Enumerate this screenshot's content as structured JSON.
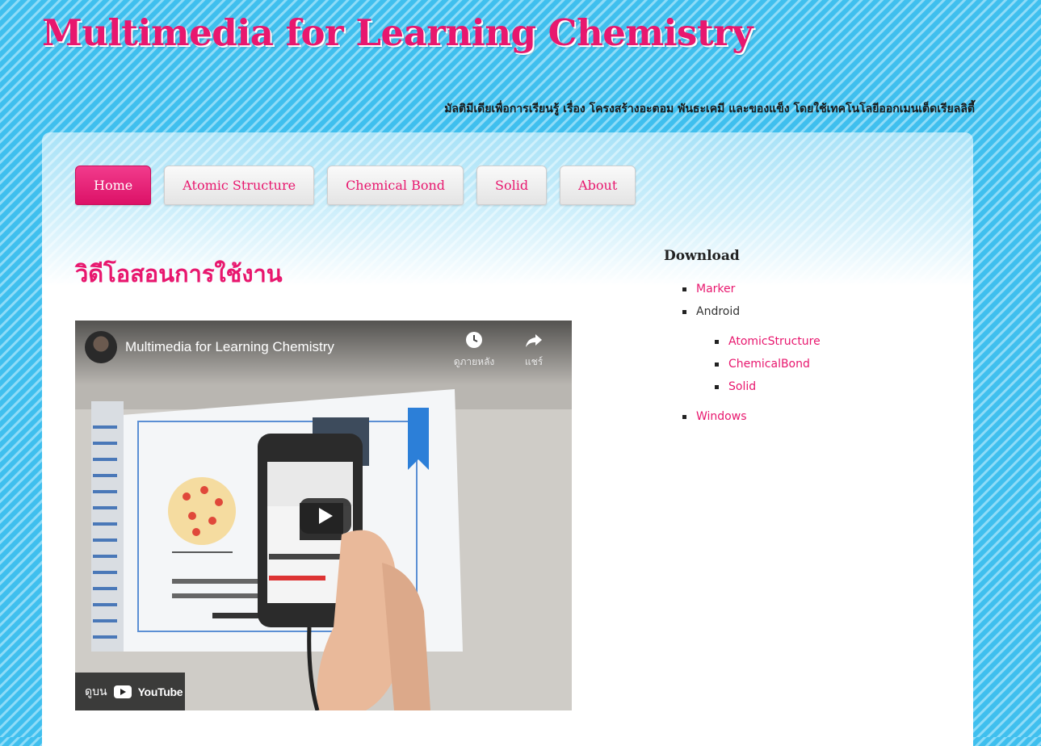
{
  "site": {
    "title": "Multimedia for Learning Chemistry",
    "tagline": "มัลติมีเดียเพื่อการเรียนรู้ เรื่อง โครงสร้างอะตอม พันธะเคมี และของแข็ง โดยใช้เทคโนโลยีออกเมนเต็ดเรียลลิตี้"
  },
  "nav": {
    "items": [
      "Home",
      "Atomic Structure",
      "Chemical Bond",
      "Solid",
      "About"
    ],
    "active": "Home"
  },
  "main": {
    "heading": "วิดีโอสอนการใช้งาน",
    "video": {
      "title": "Multimedia for Learning Chemistry",
      "watch_later": "ดูภายหลัง",
      "share": "แชร์",
      "watch_on": "ดูบน",
      "youtube": "YouTube"
    }
  },
  "sidebar": {
    "title": "Download",
    "items": {
      "marker": "Marker",
      "android": "Android",
      "android_sub": [
        "AtomicStructure",
        "ChemicalBond",
        "Solid"
      ],
      "windows": "Windows"
    }
  },
  "colors": {
    "accent": "#e8176e",
    "background": "#49c6f2",
    "panel": "#ffffff"
  },
  "icons": [
    "clock-icon",
    "share-arrow-icon",
    "play-icon",
    "youtube-logo-icon"
  ]
}
